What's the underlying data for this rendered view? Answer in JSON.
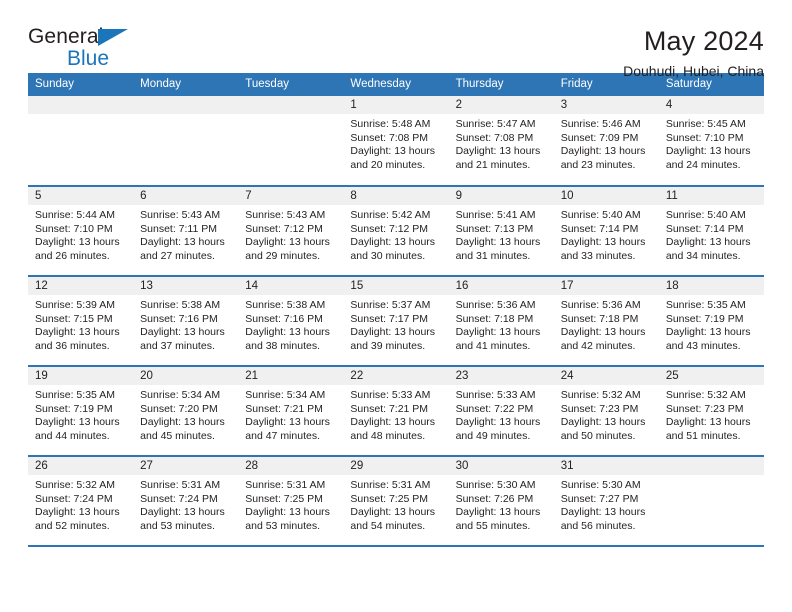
{
  "brand": {
    "name_part1": "General",
    "name_part2": "Blue",
    "accent_color": "#1b75bb"
  },
  "header": {
    "title": "May 2024",
    "subtitle": "Douhudi, Hubei, China"
  },
  "theme": {
    "header_row_color": "#2e75b6",
    "date_band_color": "#f0f0f0",
    "text_color": "#231f20"
  },
  "calendar": {
    "day_headers": [
      "Sunday",
      "Monday",
      "Tuesday",
      "Wednesday",
      "Thursday",
      "Friday",
      "Saturday"
    ],
    "weeks": [
      [
        {
          "date": "",
          "sunrise": "",
          "sunset": "",
          "daylight_line1": "",
          "daylight_line2": "",
          "empty": true
        },
        {
          "date": "",
          "sunrise": "",
          "sunset": "",
          "daylight_line1": "",
          "daylight_line2": "",
          "empty": true
        },
        {
          "date": "",
          "sunrise": "",
          "sunset": "",
          "daylight_line1": "",
          "daylight_line2": "",
          "empty": true
        },
        {
          "date": "1",
          "sunrise": "Sunrise: 5:48 AM",
          "sunset": "Sunset: 7:08 PM",
          "daylight_line1": "Daylight: 13 hours",
          "daylight_line2": "and 20 minutes."
        },
        {
          "date": "2",
          "sunrise": "Sunrise: 5:47 AM",
          "sunset": "Sunset: 7:08 PM",
          "daylight_line1": "Daylight: 13 hours",
          "daylight_line2": "and 21 minutes."
        },
        {
          "date": "3",
          "sunrise": "Sunrise: 5:46 AM",
          "sunset": "Sunset: 7:09 PM",
          "daylight_line1": "Daylight: 13 hours",
          "daylight_line2": "and 23 minutes."
        },
        {
          "date": "4",
          "sunrise": "Sunrise: 5:45 AM",
          "sunset": "Sunset: 7:10 PM",
          "daylight_line1": "Daylight: 13 hours",
          "daylight_line2": "and 24 minutes."
        }
      ],
      [
        {
          "date": "5",
          "sunrise": "Sunrise: 5:44 AM",
          "sunset": "Sunset: 7:10 PM",
          "daylight_line1": "Daylight: 13 hours",
          "daylight_line2": "and 26 minutes."
        },
        {
          "date": "6",
          "sunrise": "Sunrise: 5:43 AM",
          "sunset": "Sunset: 7:11 PM",
          "daylight_line1": "Daylight: 13 hours",
          "daylight_line2": "and 27 minutes."
        },
        {
          "date": "7",
          "sunrise": "Sunrise: 5:43 AM",
          "sunset": "Sunset: 7:12 PM",
          "daylight_line1": "Daylight: 13 hours",
          "daylight_line2": "and 29 minutes."
        },
        {
          "date": "8",
          "sunrise": "Sunrise: 5:42 AM",
          "sunset": "Sunset: 7:12 PM",
          "daylight_line1": "Daylight: 13 hours",
          "daylight_line2": "and 30 minutes."
        },
        {
          "date": "9",
          "sunrise": "Sunrise: 5:41 AM",
          "sunset": "Sunset: 7:13 PM",
          "daylight_line1": "Daylight: 13 hours",
          "daylight_line2": "and 31 minutes."
        },
        {
          "date": "10",
          "sunrise": "Sunrise: 5:40 AM",
          "sunset": "Sunset: 7:14 PM",
          "daylight_line1": "Daylight: 13 hours",
          "daylight_line2": "and 33 minutes."
        },
        {
          "date": "11",
          "sunrise": "Sunrise: 5:40 AM",
          "sunset": "Sunset: 7:14 PM",
          "daylight_line1": "Daylight: 13 hours",
          "daylight_line2": "and 34 minutes."
        }
      ],
      [
        {
          "date": "12",
          "sunrise": "Sunrise: 5:39 AM",
          "sunset": "Sunset: 7:15 PM",
          "daylight_line1": "Daylight: 13 hours",
          "daylight_line2": "and 36 minutes."
        },
        {
          "date": "13",
          "sunrise": "Sunrise: 5:38 AM",
          "sunset": "Sunset: 7:16 PM",
          "daylight_line1": "Daylight: 13 hours",
          "daylight_line2": "and 37 minutes."
        },
        {
          "date": "14",
          "sunrise": "Sunrise: 5:38 AM",
          "sunset": "Sunset: 7:16 PM",
          "daylight_line1": "Daylight: 13 hours",
          "daylight_line2": "and 38 minutes."
        },
        {
          "date": "15",
          "sunrise": "Sunrise: 5:37 AM",
          "sunset": "Sunset: 7:17 PM",
          "daylight_line1": "Daylight: 13 hours",
          "daylight_line2": "and 39 minutes."
        },
        {
          "date": "16",
          "sunrise": "Sunrise: 5:36 AM",
          "sunset": "Sunset: 7:18 PM",
          "daylight_line1": "Daylight: 13 hours",
          "daylight_line2": "and 41 minutes."
        },
        {
          "date": "17",
          "sunrise": "Sunrise: 5:36 AM",
          "sunset": "Sunset: 7:18 PM",
          "daylight_line1": "Daylight: 13 hours",
          "daylight_line2": "and 42 minutes."
        },
        {
          "date": "18",
          "sunrise": "Sunrise: 5:35 AM",
          "sunset": "Sunset: 7:19 PM",
          "daylight_line1": "Daylight: 13 hours",
          "daylight_line2": "and 43 minutes."
        }
      ],
      [
        {
          "date": "19",
          "sunrise": "Sunrise: 5:35 AM",
          "sunset": "Sunset: 7:19 PM",
          "daylight_line1": "Daylight: 13 hours",
          "daylight_line2": "and 44 minutes."
        },
        {
          "date": "20",
          "sunrise": "Sunrise: 5:34 AM",
          "sunset": "Sunset: 7:20 PM",
          "daylight_line1": "Daylight: 13 hours",
          "daylight_line2": "and 45 minutes."
        },
        {
          "date": "21",
          "sunrise": "Sunrise: 5:34 AM",
          "sunset": "Sunset: 7:21 PM",
          "daylight_line1": "Daylight: 13 hours",
          "daylight_line2": "and 47 minutes."
        },
        {
          "date": "22",
          "sunrise": "Sunrise: 5:33 AM",
          "sunset": "Sunset: 7:21 PM",
          "daylight_line1": "Daylight: 13 hours",
          "daylight_line2": "and 48 minutes."
        },
        {
          "date": "23",
          "sunrise": "Sunrise: 5:33 AM",
          "sunset": "Sunset: 7:22 PM",
          "daylight_line1": "Daylight: 13 hours",
          "daylight_line2": "and 49 minutes."
        },
        {
          "date": "24",
          "sunrise": "Sunrise: 5:32 AM",
          "sunset": "Sunset: 7:23 PM",
          "daylight_line1": "Daylight: 13 hours",
          "daylight_line2": "and 50 minutes."
        },
        {
          "date": "25",
          "sunrise": "Sunrise: 5:32 AM",
          "sunset": "Sunset: 7:23 PM",
          "daylight_line1": "Daylight: 13 hours",
          "daylight_line2": "and 51 minutes."
        }
      ],
      [
        {
          "date": "26",
          "sunrise": "Sunrise: 5:32 AM",
          "sunset": "Sunset: 7:24 PM",
          "daylight_line1": "Daylight: 13 hours",
          "daylight_line2": "and 52 minutes."
        },
        {
          "date": "27",
          "sunrise": "Sunrise: 5:31 AM",
          "sunset": "Sunset: 7:24 PM",
          "daylight_line1": "Daylight: 13 hours",
          "daylight_line2": "and 53 minutes."
        },
        {
          "date": "28",
          "sunrise": "Sunrise: 5:31 AM",
          "sunset": "Sunset: 7:25 PM",
          "daylight_line1": "Daylight: 13 hours",
          "daylight_line2": "and 53 minutes."
        },
        {
          "date": "29",
          "sunrise": "Sunrise: 5:31 AM",
          "sunset": "Sunset: 7:25 PM",
          "daylight_line1": "Daylight: 13 hours",
          "daylight_line2": "and 54 minutes."
        },
        {
          "date": "30",
          "sunrise": "Sunrise: 5:30 AM",
          "sunset": "Sunset: 7:26 PM",
          "daylight_line1": "Daylight: 13 hours",
          "daylight_line2": "and 55 minutes."
        },
        {
          "date": "31",
          "sunrise": "Sunrise: 5:30 AM",
          "sunset": "Sunset: 7:27 PM",
          "daylight_line1": "Daylight: 13 hours",
          "daylight_line2": "and 56 minutes."
        },
        {
          "date": "",
          "sunrise": "",
          "sunset": "",
          "daylight_line1": "",
          "daylight_line2": "",
          "empty": true
        }
      ]
    ]
  }
}
